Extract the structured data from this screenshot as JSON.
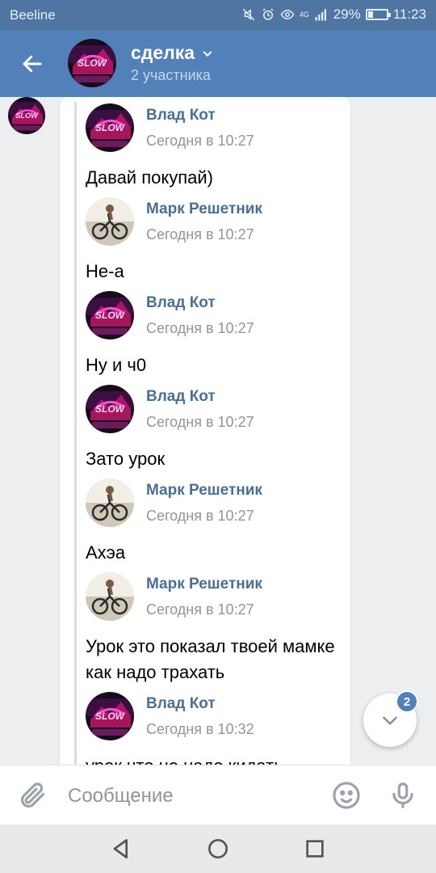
{
  "status_bar": {
    "carrier": "Beeline",
    "network_label": "4G",
    "battery": "29%",
    "battery_level": 0.29,
    "time": "11:23"
  },
  "header": {
    "title": "сделка",
    "subtitle": "2 участника"
  },
  "messages": [
    {
      "author": "Влад Кот",
      "time": "Сегодня в 10:27",
      "text": "Давай покупай)",
      "avatar": "neon-avatar"
    },
    {
      "author": "Марк Решетник",
      "time": "Сегодня в 10:27",
      "text": "Не-а",
      "avatar": "bike-avatar"
    },
    {
      "author": "Влад Кот",
      "time": "Сегодня в 10:27",
      "text": "Ну и ч0",
      "avatar": "neon-avatar"
    },
    {
      "author": "Влад Кот",
      "time": "Сегодня в 10:27",
      "text": "Зато урок",
      "avatar": "neon-avatar"
    },
    {
      "author": "Марк Решетник",
      "time": "Сегодня в 10:27",
      "text": "Ахэа",
      "avatar": "bike-avatar"
    },
    {
      "author": "Марк Решетник",
      "time": "Сегодня в 10:27",
      "text": "Урок это показал твоей мамке как надо трахать",
      "avatar": "bike-avatar"
    },
    {
      "author": "Влад Кот",
      "time": "Сегодня в 10:32",
      "text": "урок что не надо кидать",
      "avatar": "neon-avatar"
    }
  ],
  "scroll_button": {
    "badge": "2"
  },
  "composer": {
    "placeholder": "Сообщение"
  },
  "colors": {
    "header": "#5181b8",
    "status_bar": "#4f76a2",
    "author_name": "#4a6f97",
    "background": "#edeef0"
  }
}
